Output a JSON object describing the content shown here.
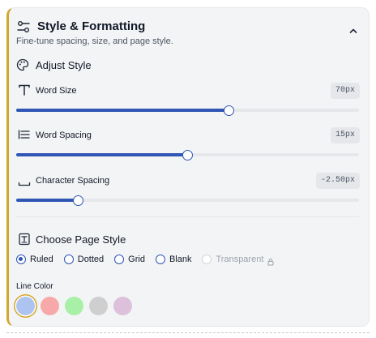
{
  "header": {
    "title": "Style & Formatting",
    "subtitle": "Fine-tune spacing, size, and page style.",
    "icon": "sliders-icon",
    "collapse_icon": "chevron-up-icon"
  },
  "adjust_style": {
    "title": "Adjust Style",
    "icon": "palette-icon"
  },
  "sliders": [
    {
      "label": "Word Size",
      "value": "70px",
      "fill_fraction": 0.62,
      "icon": "text-size-icon"
    },
    {
      "label": "Word Spacing",
      "value": "15px",
      "fill_fraction": 0.5,
      "icon": "word-spacing-icon"
    },
    {
      "label": "Character Spacing",
      "value": "-2.50px",
      "fill_fraction": 0.18,
      "icon": "character-spacing-icon"
    }
  ],
  "page_style": {
    "title": "Choose Page Style",
    "icon": "page-icon",
    "options": [
      {
        "label": "Ruled",
        "checked": true,
        "disabled": false
      },
      {
        "label": "Dotted",
        "checked": false,
        "disabled": false
      },
      {
        "label": "Grid",
        "checked": false,
        "disabled": false
      },
      {
        "label": "Blank",
        "checked": false,
        "disabled": false
      },
      {
        "label": "Transparent",
        "checked": false,
        "disabled": true,
        "icon": "lock-icon"
      }
    ]
  },
  "line_color": {
    "label": "Line Color",
    "swatches": [
      {
        "color": "#aec4f0",
        "selected": true
      },
      {
        "color": "#f7a8a8",
        "selected": false
      },
      {
        "color": "#a8f0a8",
        "selected": false
      },
      {
        "color": "#cfcfcf",
        "selected": false
      },
      {
        "color": "#dcc0dc",
        "selected": false
      }
    ]
  },
  "colors": {
    "accent": "#2f55b5",
    "panel_border_accent": "#d4a62a",
    "panel_bg": "#f3f4f6"
  }
}
